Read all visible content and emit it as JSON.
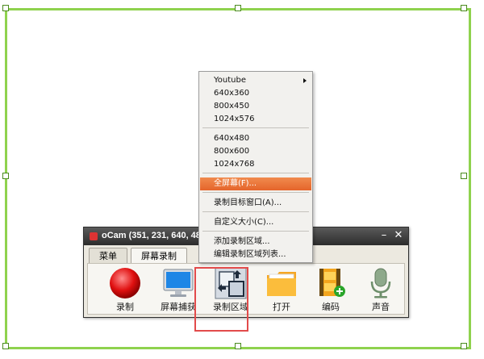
{
  "window": {
    "title": "oCam (351, 231, 640, 48",
    "minimize": "–",
    "close": "✕"
  },
  "tabs": [
    {
      "label": "菜单"
    },
    {
      "label": "屏幕录制"
    }
  ],
  "toolbar": [
    {
      "label": "录制",
      "icon": "record-icon"
    },
    {
      "label": "屏幕捕获",
      "icon": "monitor-icon"
    },
    {
      "label": "录制区域",
      "icon": "resize-region-icon"
    },
    {
      "label": "打开",
      "icon": "folder-icon"
    },
    {
      "label": "编码",
      "icon": "film-add-icon"
    },
    {
      "label": "声音",
      "icon": "microphone-icon"
    }
  ],
  "menu": {
    "youtube": "Youtube",
    "r640x360": "640x360",
    "r800x450": "800x450",
    "r1024x576": "1024x576",
    "r640x480": "640x480",
    "r800x600": "800x600",
    "r1024x768": "1024x768",
    "fullscreen": "全屏幕(F)...",
    "target_window": "录制目标窗口(A)...",
    "custom_size": "自定义大小(C)...",
    "add_region": "添加录制区域...",
    "edit_region_list": "编辑录制区域列表..."
  },
  "colors": {
    "frame_border": "#8fd24e",
    "menu_highlight": "#e5652b",
    "callout": "#e24b4b"
  }
}
